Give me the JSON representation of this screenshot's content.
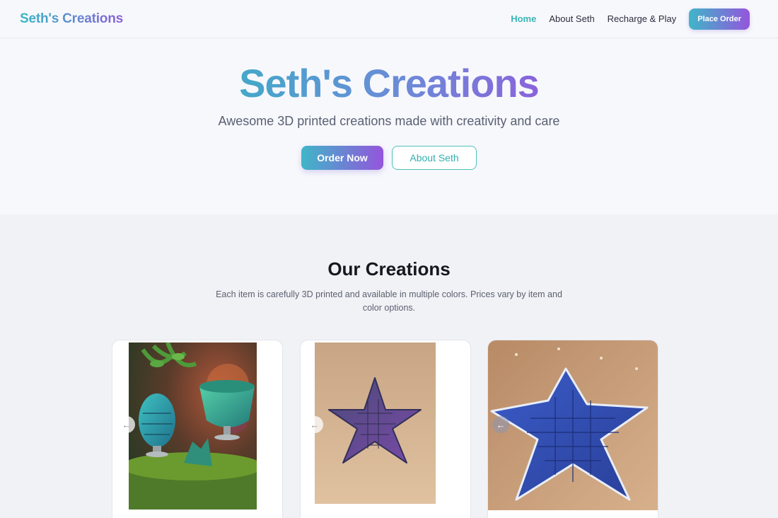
{
  "nav": {
    "brand": "Seth's Creations",
    "links": [
      "Home",
      "About Seth",
      "Recharge & Play"
    ],
    "cta": "Place Order"
  },
  "hero": {
    "title": "Seth's Creations",
    "subtitle": "Awesome 3D printed creations made with creativity and care",
    "primary_button": "Order Now",
    "secondary_button": "About Seth"
  },
  "creations": {
    "title": "Our Creations",
    "description": "Each item is carefully 3D printed and available in multiple colors. Prices vary by item and color options.",
    "cards": [
      {
        "image": "green-dragon-egg-and-goblet-photo",
        "arrow_icon": "arrow-left-icon"
      },
      {
        "image": "purple-starfish-on-sand-photo",
        "arrow_icon": "arrow-left-icon"
      },
      {
        "image": "blue-starfish-on-sand-photo",
        "arrow_icon": "arrow-left-icon"
      }
    ]
  },
  "colors": {
    "accent_teal": "#3ab4b4",
    "accent_purple": "#9455dc"
  }
}
